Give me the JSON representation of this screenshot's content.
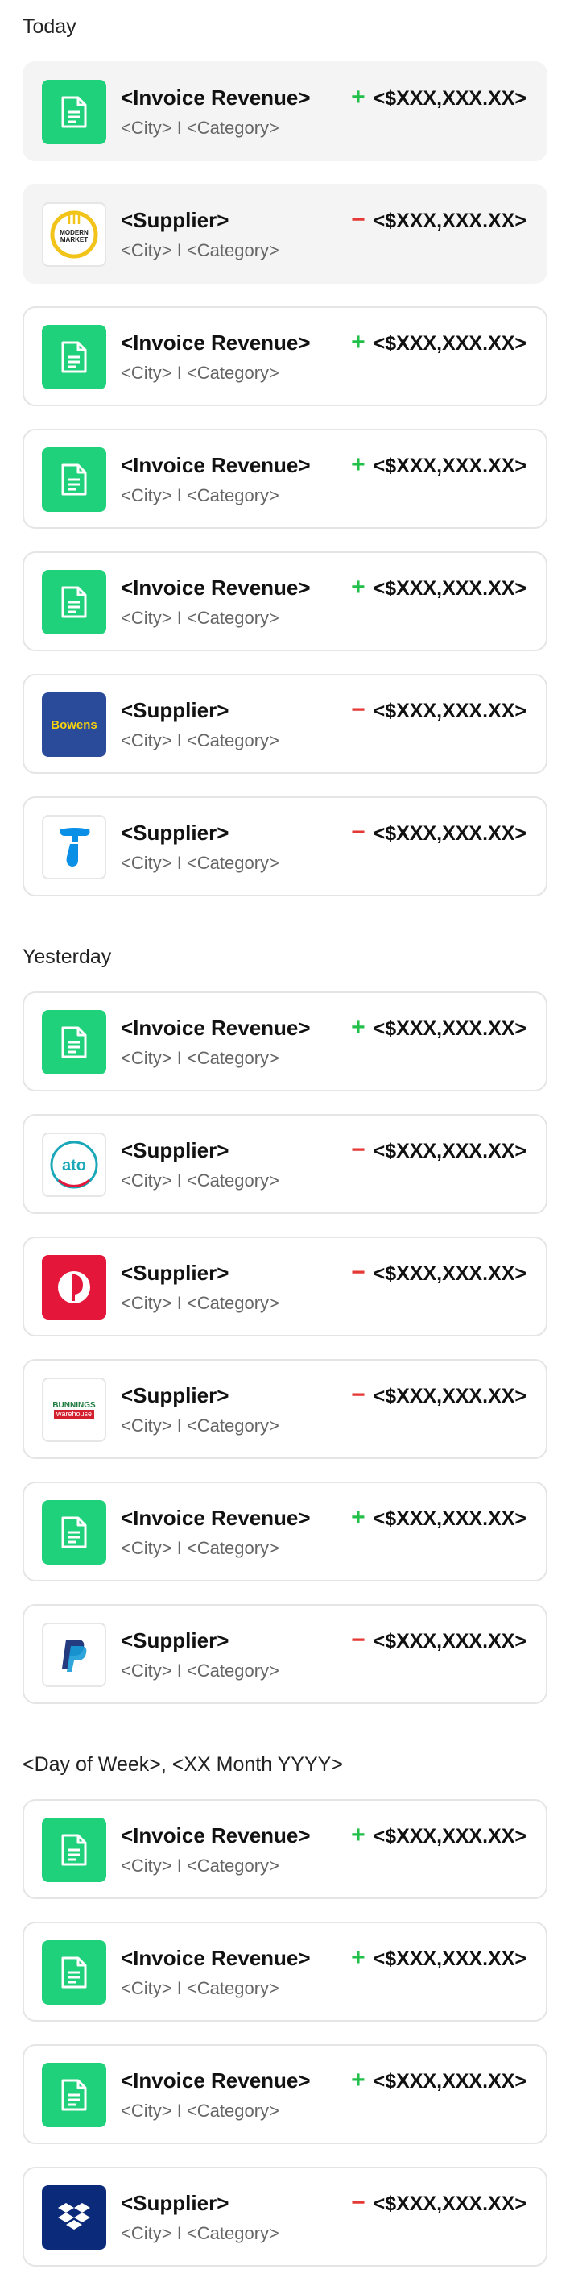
{
  "sections": [
    {
      "title": "Today"
    },
    {
      "title": "Yesterday"
    },
    {
      "title": "<Day of Week>, <XX Month YYYY>"
    }
  ],
  "signs": {
    "plus": "+",
    "minus": "−"
  },
  "transactions": {
    "invoice": {
      "title": "<Invoice Revenue>",
      "subtitle": "<City> I <Category>",
      "amount": "<$XXX,XXX.XX>"
    },
    "supplier": {
      "title": "<Supplier>",
      "subtitle": "<City> I <Category>",
      "amount": "<$XXX,XXX.XX>"
    }
  },
  "logos": {
    "modern_market": {
      "line1": "MODERN",
      "line2": "MARKET"
    },
    "bowens": "Bowens",
    "ato": "ato",
    "bunnings": {
      "line1": "BUNNINGS",
      "line2": "warehouse"
    }
  },
  "colors": {
    "invoice_green": "#1fd17a",
    "plus_green": "#22c04a",
    "minus_red": "#e53935",
    "bowens_blue": "#2a4a9a",
    "bowens_yellow": "#f6d20a",
    "telstra_blue": "#0a8fe6",
    "ato_teal": "#1aa7b7",
    "auspost_red": "#e4163a",
    "paypal_navy": "#253b80",
    "paypal_blue": "#179bd7",
    "dropbox_navy": "#0b2a7a"
  }
}
